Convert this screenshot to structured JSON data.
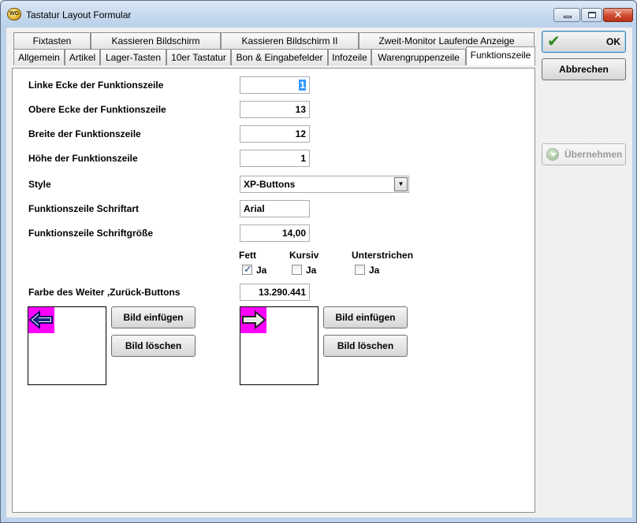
{
  "window": {
    "title": "Tastatur Layout Formular",
    "app_icon_text": "WG"
  },
  "tabs": {
    "row1": [
      {
        "label": "Fixtasten"
      },
      {
        "label": "Kassieren Bildschirm"
      },
      {
        "label": "Kassieren Bildschirm II"
      },
      {
        "label": "Zweit-Monitor Laufende Anzeige"
      }
    ],
    "row2": [
      {
        "label": "Allgemein"
      },
      {
        "label": "Artikel"
      },
      {
        "label": "Lager-Tasten"
      },
      {
        "label": "10er Tastatur"
      },
      {
        "label": "Bon & Eingabefelder"
      },
      {
        "label": "Infozeile"
      },
      {
        "label": "Warengruppenzeile"
      },
      {
        "label": "Funktionszeile",
        "active": true
      }
    ]
  },
  "form": {
    "linke_ecke": {
      "label": "Linke Ecke der Funktionszeile",
      "value": "1"
    },
    "obere_ecke": {
      "label": "Obere Ecke der Funktionszeile",
      "value": "13"
    },
    "breite": {
      "label": "Breite der Funktionszeile",
      "value": "12"
    },
    "hoehe": {
      "label": "Höhe der Funktionszeile",
      "value": "1"
    },
    "style": {
      "label": "Style",
      "value": "XP-Buttons"
    },
    "schriftart": {
      "label": "Funktionszeile Schriftart",
      "value": "Arial"
    },
    "schriftgroesse": {
      "label": "Funktionszeile Schriftgröße",
      "value": "14,00"
    },
    "fett": {
      "label": "Fett",
      "option": "Ja",
      "checked": true
    },
    "kursiv": {
      "label": "Kursiv",
      "option": "Ja",
      "checked": false
    },
    "unterstrichen": {
      "label": "Unterstrichen",
      "option": "Ja",
      "checked": false
    },
    "farbe": {
      "label": "Farbe des Weiter ,Zurück-Buttons",
      "value": "13.290.441"
    }
  },
  "images": {
    "left": {
      "icon": "arrow-left-icon",
      "insert_label": "Bild einfügen",
      "delete_label": "Bild löschen"
    },
    "right": {
      "icon": "arrow-right-icon",
      "insert_label": "Bild einfügen",
      "delete_label": "Bild löschen"
    },
    "background_color": "#ff00ff"
  },
  "actions": {
    "ok_label": "OK",
    "cancel_label": "Abbrechen",
    "apply_label": "Übernehmen"
  }
}
